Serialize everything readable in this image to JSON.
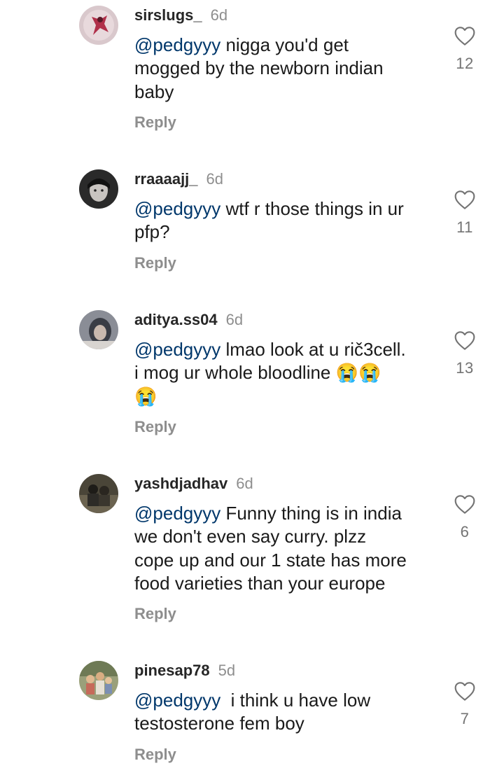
{
  "comments": [
    {
      "username": "sirslugs_",
      "time": "6d",
      "mention": "@pedgyyy",
      "text": " nigga you'd get\nmogged by the newborn indian\nbaby",
      "reply_label": "Reply",
      "likes": "12",
      "avatar_icon": "avatar-red-figure"
    },
    {
      "username": "rraaaajj_",
      "time": "6d",
      "mention": "@pedgyyy",
      "text": " wtf r those things in ur\npfp?",
      "reply_label": "Reply",
      "likes": "11",
      "avatar_icon": "avatar-dark-face"
    },
    {
      "username": "aditya.ss04",
      "time": "6d",
      "mention": "@pedgyyy",
      "text": " lmao look at u rič3cell.\ni mog ur whole bloodline ",
      "emoji": "😭😭",
      "text_after": "😭",
      "reply_label": "Reply",
      "likes": "13",
      "avatar_icon": "avatar-hooded"
    },
    {
      "username": "yashdjadhav",
      "time": "6d",
      "mention": "@pedgyyy",
      "text": " Funny thing is in india\nwe don't even say curry. plzz\ncope up and our 1 state has more\nfood varieties than your europe",
      "reply_label": "Reply",
      "likes": "6",
      "avatar_icon": "avatar-group-photo"
    },
    {
      "username": "pinesap78",
      "time": "5d",
      "mention": "@pedgyyy",
      "text": "  i think u have low\ntestosterone fem boy",
      "reply_label": "Reply",
      "likes": "7",
      "avatar_icon": "avatar-family-photo"
    }
  ],
  "colors": {
    "mention": "#00376b",
    "username": "#262626",
    "muted": "#8e8e8e"
  }
}
